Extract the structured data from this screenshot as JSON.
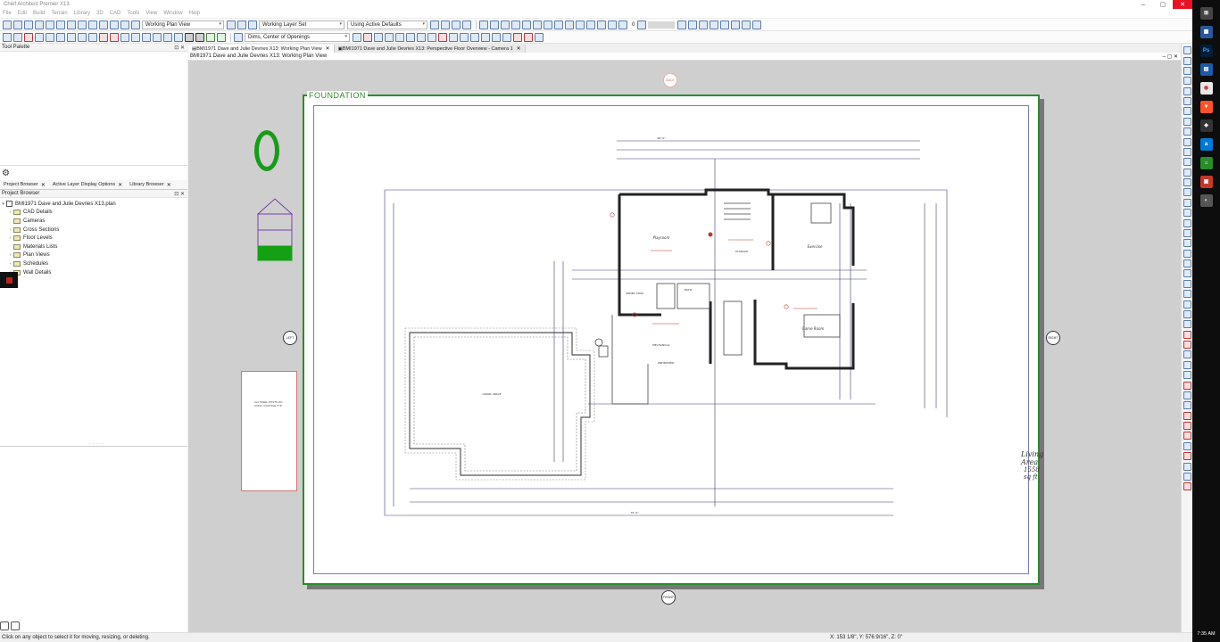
{
  "window": {
    "title": "Chief Architect Premier X13"
  },
  "menu": [
    "File",
    "Edit",
    "Build",
    "Terrain",
    "Library",
    "3D",
    "CAD",
    "Tools",
    "View",
    "Window",
    "Help"
  ],
  "toolbar": {
    "plan_view_combo": "Working Plan View",
    "layer_set_combo": "Working Layer Set",
    "defaults_combo": "Using Active Defaults",
    "dims_combo": "Dims, Center of Openings",
    "counter": "0"
  },
  "tool_palette": {
    "title": "Tool Palette"
  },
  "panel_tabs": [
    "Project Browser",
    "Active Layer Display Options",
    "Library Browser"
  ],
  "project_browser": {
    "title": "Project Browser",
    "root": "BMI1971 Dave and Julie Devries X13.plan",
    "items": [
      "CAD Details",
      "Cameras",
      "Cross Sections",
      "Floor Levels",
      "Materials Lists",
      "Plan Views",
      "Schedules",
      "Wall Details"
    ]
  },
  "doc_tabs": [
    "BMI1971 Dave and Julie Devries X13:  Working Plan View",
    "BMI1971 Dave and Julie Devries X13:  Perspective Floor Overview - Camera 1"
  ],
  "doc_title": "BMI1971 Dave and Julie Devries X13:  Working Plan View",
  "canvas": {
    "sheet_label": "FOUNDATION",
    "floor_indicator": "0",
    "living_area_label": "Living Area",
    "living_area_value": "1558 sq ft",
    "thumb_note": "2x4 STEEL POSTS ON CONC. FOOTING TYP.",
    "plan_labels": {
      "crawl": "CRAWL SPACE",
      "family": "FAMILY ROOM",
      "playroom": "Playroom",
      "storage": "STORAGE",
      "exercise": "Exercise",
      "game": "Game Room",
      "mech": "MECHANICAL",
      "unfinished": "UNFINISHED",
      "closet": "UNDER STAIR",
      "bath": "BATH",
      "dim_top": "96'-0\"",
      "dim_bottom": "76'-0\""
    },
    "markers": {
      "left": "LEFT",
      "right": "RIGHT",
      "front": "FRONT",
      "back": "BACK"
    }
  },
  "status": {
    "message": "Click on any object to select it for moving, resizing, or deleting.",
    "coords": "X: 153 1/8\", Y: 576 9/16\", Z: 0\""
  },
  "taskbar": {
    "clock": "7:35 AM"
  },
  "colors": {
    "sheet_border": "#2a8c2a",
    "accent": "#5b7da8"
  }
}
